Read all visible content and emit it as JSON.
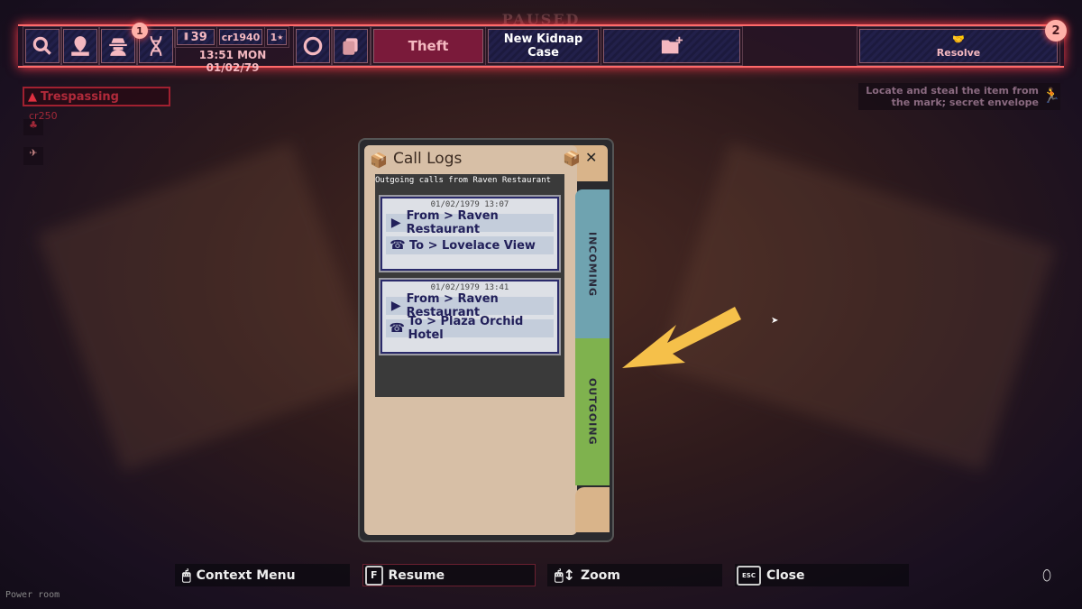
{
  "paused_label": "PAUSED",
  "topbar": {
    "notification_badge": "1",
    "ammo": "39",
    "credits": "cr1940",
    "stars": "1",
    "clock": "13:51 MON 01/02/79",
    "theft_label": "Theft",
    "new_case_label": "New Kidnap Case",
    "resolve_label": "Resolve",
    "resolve_badge": "2",
    "accent": "#ff6a6a"
  },
  "alert": {
    "label": "Trespassing",
    "amount": "cr250"
  },
  "objective": "Locate and steal the item from the mark; secret envelope",
  "dialog": {
    "title": "Call Logs",
    "subtitle": "Outgoing calls from Raven Restaurant",
    "calls": [
      {
        "timestamp": "01/02/1979 13:07",
        "from": "From > Raven Restaurant",
        "to": "To > Lovelace View"
      },
      {
        "timestamp": "01/02/1979 13:41",
        "from": "From > Raven Restaurant",
        "to": "To > Plaza Orchid Hotel"
      }
    ],
    "tabs": [
      {
        "label": "Incoming",
        "color": "#6fa3b0"
      },
      {
        "label": "Outgoing",
        "color": "#7fb24e",
        "active": true
      }
    ]
  },
  "hints": [
    {
      "key": "",
      "label": "Context Menu"
    },
    {
      "key": "F",
      "label": "Resume"
    },
    {
      "key": "",
      "label": "Zoom"
    },
    {
      "key": "ESC",
      "label": "Close"
    }
  ],
  "location": "Power room"
}
